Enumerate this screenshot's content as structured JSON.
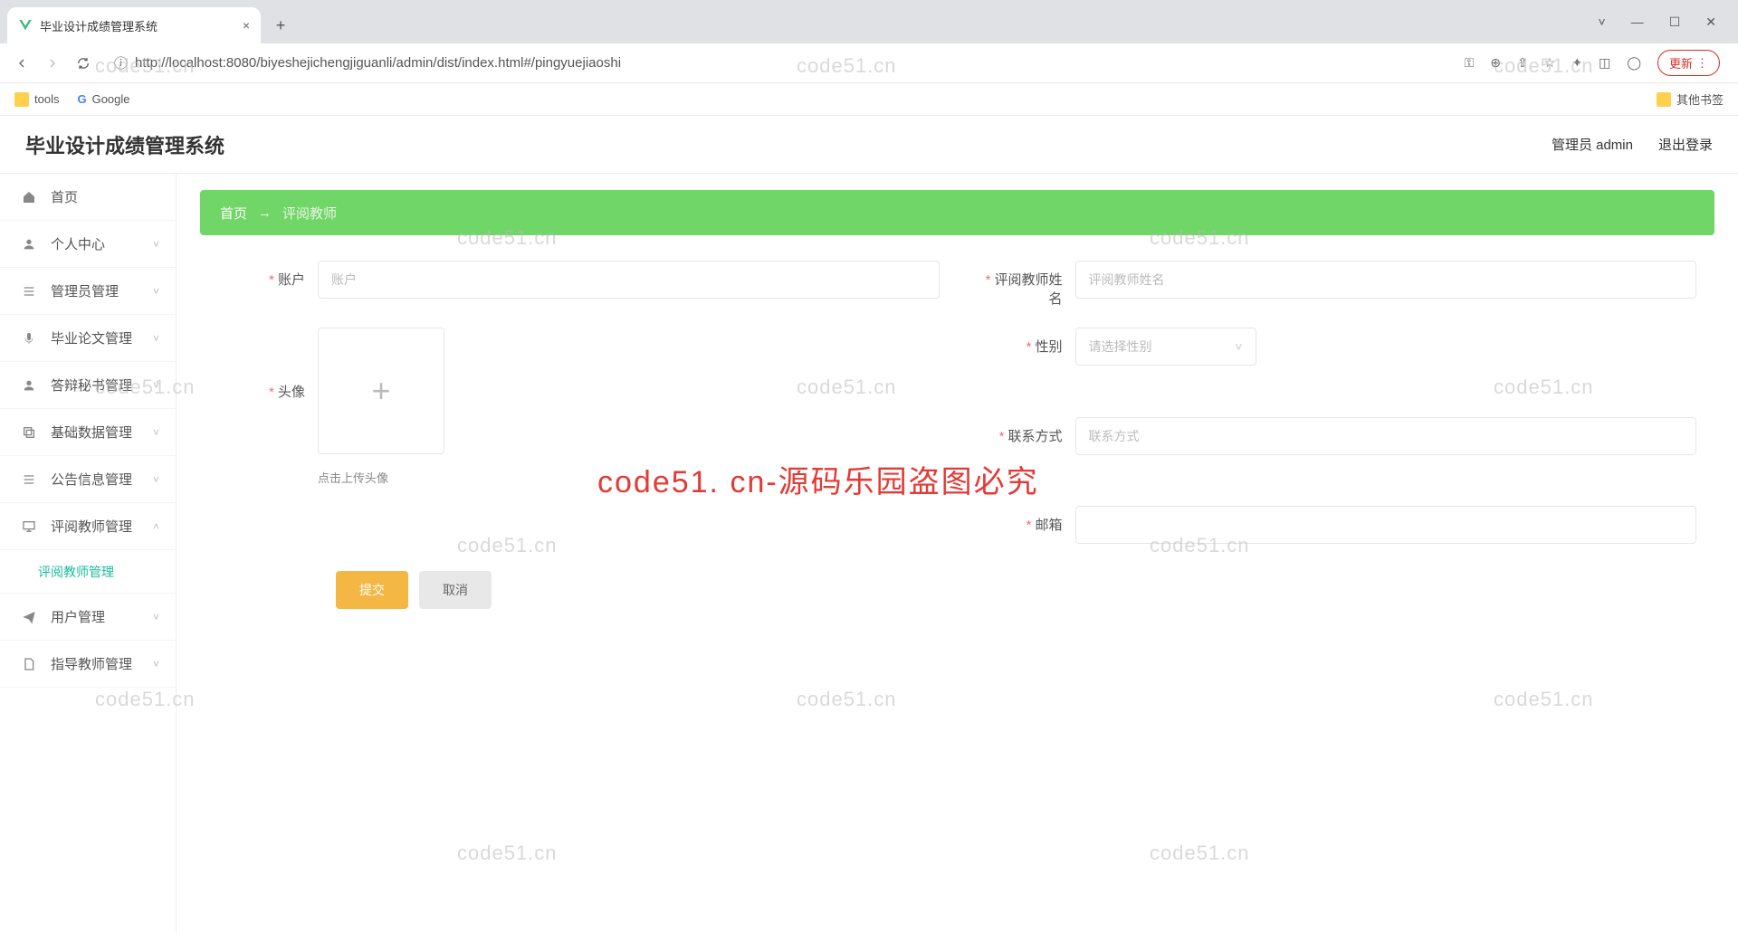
{
  "browser": {
    "tab_title": "毕业设计成绩管理系统",
    "url": "http://localhost:8080/biyeshejichengjiguanli/admin/dist/index.html#/pingyuejiaoshi",
    "bookmarks": {
      "tools": "tools",
      "google": "Google",
      "other": "其他书签"
    },
    "update_btn": "更新"
  },
  "header": {
    "app_title": "毕业设计成绩管理系统",
    "user_label": "管理员 admin",
    "logout": "退出登录"
  },
  "sidebar": {
    "items": [
      {
        "label": "首页",
        "icon": "home"
      },
      {
        "label": "个人中心",
        "icon": "user",
        "expand": true
      },
      {
        "label": "管理员管理",
        "icon": "list",
        "expand": true
      },
      {
        "label": "毕业论文管理",
        "icon": "mic",
        "expand": true
      },
      {
        "label": "答辩秘书管理",
        "icon": "person",
        "expand": true
      },
      {
        "label": "基础数据管理",
        "icon": "copy",
        "expand": true
      },
      {
        "label": "公告信息管理",
        "icon": "list",
        "expand": true
      },
      {
        "label": "评阅教师管理",
        "icon": "monitor",
        "expand": true,
        "open": true,
        "sub": "评阅教师管理"
      },
      {
        "label": "用户管理",
        "icon": "send",
        "expand": true
      },
      {
        "label": "指导教师管理",
        "icon": "file",
        "expand": true
      }
    ]
  },
  "breadcrumb": {
    "home": "首页",
    "current": "评阅教师"
  },
  "form": {
    "account": {
      "label": "账户",
      "placeholder": "账户"
    },
    "teacher_name": {
      "label": "评阅教师姓名",
      "placeholder": "评阅教师姓名"
    },
    "avatar": {
      "label": "头像",
      "hint": "点击上传头像"
    },
    "gender": {
      "label": "性别",
      "placeholder": "请选择性别"
    },
    "contact": {
      "label": "联系方式",
      "placeholder": "联系方式"
    },
    "email": {
      "label": "邮箱",
      "placeholder": ""
    },
    "submit": "提交",
    "cancel": "取消"
  },
  "watermarks": {
    "text": "code51.cn",
    "red": "code51. cn-源码乐园盗图必究"
  }
}
